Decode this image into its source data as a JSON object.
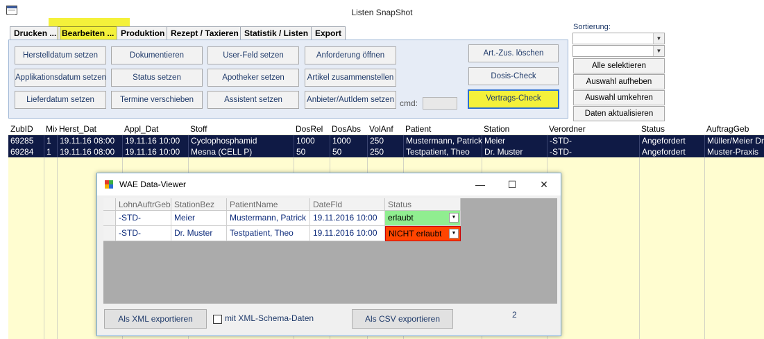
{
  "window": {
    "title": "Listen SnapShot"
  },
  "tabs": [
    {
      "label": "Drucken ..."
    },
    {
      "label": "Bearbeiten ..."
    },
    {
      "label": "Produktion"
    },
    {
      "label": "Rezept / Taxieren"
    },
    {
      "label": "Statistik / Listen"
    },
    {
      "label": "Export"
    }
  ],
  "panel": {
    "buttons": {
      "herstelldatum": "Herstelldatum setzen",
      "applikationsdatum": "Applikationsdatum setzen",
      "lieferdatum": "Lieferdatum setzen",
      "dokumentieren": "Dokumentieren",
      "status": "Status setzen",
      "termine": "Termine verschieben",
      "userfeld": "User-Feld setzen",
      "apotheker": "Apotheker setzen",
      "assistent": "Assistent setzen",
      "anforderung": "Anforderung öffnen",
      "artikel": "Artikel zusammenstellen",
      "anbieter": "Anbieter/AutIdem setzen",
      "artzus": "Art.-Zus. löschen",
      "dosis": "Dosis-Check",
      "vertrags": "Vertrags-Check"
    },
    "cmd_label": "cmd:",
    "cmd_value": ""
  },
  "sort": {
    "label": "Sortierung:",
    "combo1_value": "",
    "combo2_value": "",
    "buttons": {
      "alle": "Alle selektieren",
      "auswahl_auf": "Auswahl aufheben",
      "auswahl_um": "Auswahl umkehren",
      "daten": "Daten aktualisieren"
    }
  },
  "grid": {
    "headers": [
      "ZubID",
      "Mix",
      "Herst_Dat",
      "Appl_Dat",
      "Stoff",
      "DosRel",
      "DosAbs",
      "VolAnf",
      "Patient",
      "Station",
      "Verordner",
      "Status",
      "AuftragGeb"
    ],
    "rows": [
      [
        "69285",
        "1",
        "19.11.16 08:00",
        "19.11.16 10:00",
        "Cyclophosphamid",
        "1000",
        "1000",
        "250",
        "Mustermann, Patrick",
        "Meier",
        "-STD-",
        "Angefordert",
        "Müller/Meier Dr."
      ],
      [
        "69284",
        "1",
        "19.11.16 08:00",
        "19.11.16 10:00",
        "Mesna (CELL P)",
        "50",
        "50",
        "250",
        "Testpatient, Theo",
        "Dr. Muster",
        "-STD-",
        "Angefordert",
        "Muster-Praxis"
      ]
    ]
  },
  "viewer": {
    "title": "WAE Data-Viewer",
    "headers": [
      "LohnAuftrGeb",
      "StationBez",
      "PatientName",
      "DateFld",
      "Status"
    ],
    "rows": [
      [
        "-STD-",
        "Meier",
        "Mustermann, Patrick",
        "19.11.2016 10:00",
        "erlaubt"
      ],
      [
        "-STD-",
        "Dr. Muster",
        "Testpatient, Theo",
        "19.11.2016 10:00",
        "NICHT erlaubt"
      ]
    ],
    "status_colors": {
      "erlaubt": "#90ee90",
      "nicht_erlaubt": "#ff4500"
    },
    "export_xml": "Als XML exportieren",
    "xml_schema_label": "mit XML-Schema-Daten",
    "xml_schema_checked": false,
    "export_csv": "Als CSV exportieren",
    "count": "2"
  }
}
